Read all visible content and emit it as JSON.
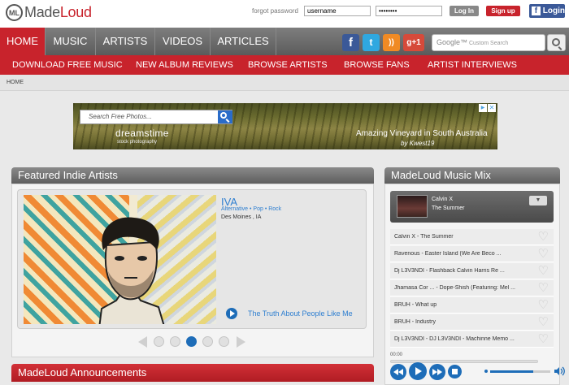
{
  "header": {
    "logo_mark": "ML",
    "logo_made": "Made",
    "logo_loud": "Loud",
    "forgot_password": "forgot password",
    "username_value": "username",
    "password_value": "••••••••",
    "login_label": "Log In",
    "signup_label": "Sign up",
    "fb_login_label": "Login"
  },
  "nav": {
    "items": [
      "HOME",
      "MUSIC",
      "ARTISTS",
      "VIDEOS",
      "ARTICLES"
    ],
    "active": "HOME",
    "search_placeholder": "Custom Search",
    "search_brand": "Google™",
    "social": [
      "f",
      "t",
      "rss",
      "g+1"
    ]
  },
  "subnav": {
    "items": [
      "DOWNLOAD FREE MUSIC",
      "NEW ALBUM REVIEWS",
      "BROWSE ARTISTS",
      "BROWSE FANS",
      "ARTIST INTERVIEWS"
    ]
  },
  "breadcrumb": "HOME",
  "ad": {
    "search_placeholder": "Search Free Photos...",
    "brand": "dreamstime",
    "brand_sub": "stock photography",
    "caption": "Amazing Vineyard in South Australia",
    "credit": "by Kwest19"
  },
  "featured": {
    "title": "Featured Indie Artists",
    "artist_name": "IVA",
    "genres": "Alternative • Pop • Rock",
    "location": "Des Moines , IA",
    "track": "The Truth About People Like Me",
    "dots": 5,
    "active_dot": 3
  },
  "announcements": {
    "title": "MadeLoud Announcements"
  },
  "mix": {
    "title": "MadeLoud Music Mix",
    "now_artist": "Calvin X",
    "now_title": "The Summer",
    "tracks": [
      "Calvin X - The Summer",
      "Ravenous - Easter Island (We Are Beco ...",
      "Dj L3V3NDI - Flashback Calvin Harris Re ...",
      "Jhamasa Cor ... - Dope-Shish (Featuring: Mel ...",
      "BRUH - What up",
      "BRUH - Industry",
      "Dj L3V3NDI - DJ L3V3NDI - Machinne Memo ..."
    ],
    "time": "00:00",
    "volume_fraction": 0.72
  },
  "colors": {
    "brand_red": "#c8232c",
    "accent_blue": "#1e6db8",
    "nav_gray": "#6d6d6d"
  }
}
